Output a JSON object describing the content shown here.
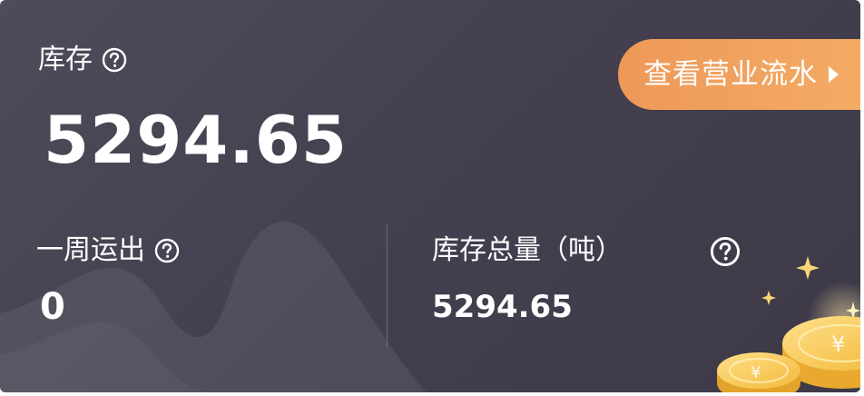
{
  "inventory": {
    "label": "库存",
    "value": "5294.65"
  },
  "cta": {
    "label": "查看营业流水"
  },
  "weekly_out": {
    "label": "一周运出",
    "value": "0"
  },
  "total_stock": {
    "label": "库存总量（吨）",
    "value": "5294.65"
  },
  "icons": {
    "help": "question-circle-icon",
    "arrow": "triangle-right-icon",
    "decoration": "gold-coins-icon"
  },
  "colors": {
    "card_bg": "#46424f",
    "cta_start": "#ee9857",
    "cta_end": "#f4ad66",
    "coin": "#f5c242"
  }
}
